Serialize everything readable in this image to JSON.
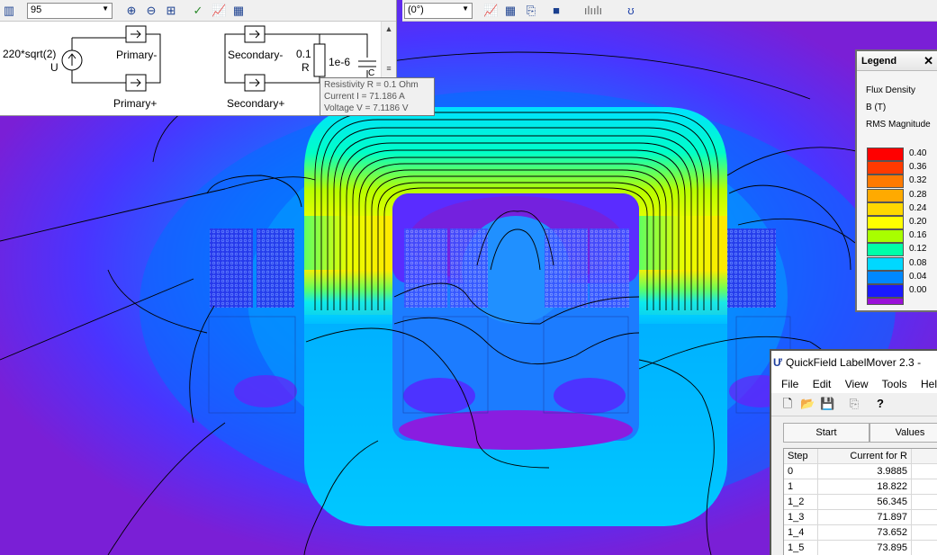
{
  "circuit_toolbar": {
    "zoom_value": "95"
  },
  "field_toolbar": {
    "angle_value": "(0°)"
  },
  "circuit": {
    "source_label": "220*sqrt(2)",
    "source_name": "U",
    "primary_minus": "Primary-",
    "primary_plus": "Primary+",
    "secondary_minus": "Secondary-",
    "secondary_plus": "Secondary+",
    "resistor_value": "0.1",
    "resistor_name": "R",
    "capacitor_value": "1e-6",
    "capacitor_name": "C"
  },
  "tooltip": {
    "line1": "Resistivity R = 0.1 Ohm",
    "line2": "Current I = 71.186 A",
    "line3": "Voltage V = 7.1186 V"
  },
  "legend": {
    "title": "Legend",
    "line1": "Flux Density",
    "line2": "B (T)",
    "line3": "RMS Magnitude",
    "entries": [
      {
        "label": "0.40",
        "color": "#ff0000"
      },
      {
        "label": "0.36",
        "color": "#ff3a00"
      },
      {
        "label": "0.32",
        "color": "#ff7a00"
      },
      {
        "label": "0.28",
        "color": "#ffaa00"
      },
      {
        "label": "0.24",
        "color": "#ffd800"
      },
      {
        "label": "0.20",
        "color": "#ffff00"
      },
      {
        "label": "0.16",
        "color": "#a8ff00"
      },
      {
        "label": "0.12",
        "color": "#00ffa8"
      },
      {
        "label": "0.08",
        "color": "#00d8ff"
      },
      {
        "label": "0.04",
        "color": "#0088ff"
      },
      {
        "label": "0.00",
        "color": "#1a1aff"
      }
    ],
    "bottom_color": "#9a10d8"
  },
  "labelmover": {
    "title": "QuickField LabelMover 2.3 -",
    "menu": [
      "File",
      "Edit",
      "View",
      "Tools",
      "Help"
    ],
    "buttons": {
      "start": "Start",
      "values": "Values"
    },
    "columns": [
      "Step",
      "Current for R"
    ],
    "rows": [
      {
        "step": "0",
        "current": "3.9885"
      },
      {
        "step": "1",
        "current": "18.822"
      },
      {
        "step": "1_2",
        "current": "56.345"
      },
      {
        "step": "1_3",
        "current": "71.897"
      },
      {
        "step": "1_4",
        "current": "73.652"
      },
      {
        "step": "1_5",
        "current": "73.895"
      }
    ]
  }
}
